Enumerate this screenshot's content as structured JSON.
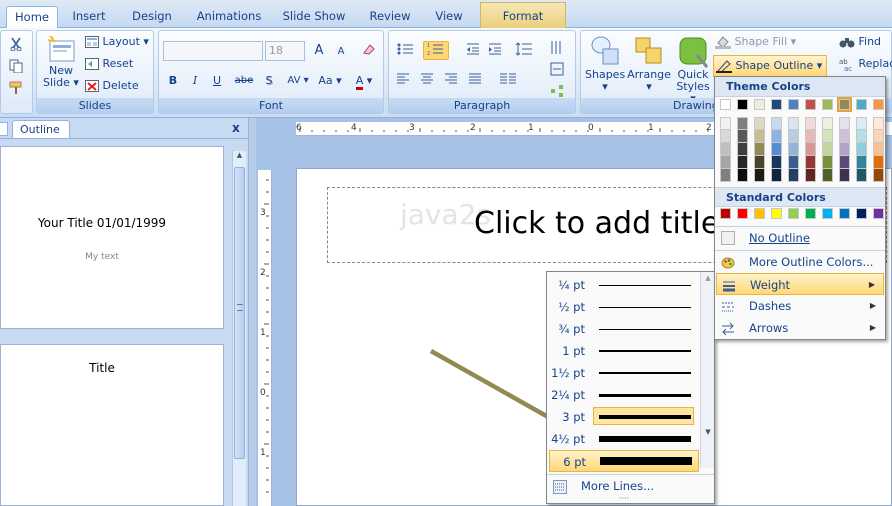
{
  "tabs": [
    {
      "label": "Home",
      "active": true
    },
    {
      "label": "Insert"
    },
    {
      "label": "Design"
    },
    {
      "label": "Animations"
    },
    {
      "label": "Slide Show"
    },
    {
      "label": "Review"
    },
    {
      "label": "View"
    },
    {
      "label": "Format"
    }
  ],
  "ribbon": {
    "slides": {
      "label": "Slides",
      "new_slide_1": "New",
      "new_slide_2": "Slide",
      "layout": "Layout",
      "reset": "Reset",
      "delete": "Delete"
    },
    "font": {
      "label": "Font",
      "size": "18",
      "bold": "B",
      "italic": "I",
      "underline": "U",
      "strike": "abe",
      "shadow": "S",
      "spacing": "AV",
      "case": "Aa",
      "color": "A",
      "grow": "A",
      "shrink": "A"
    },
    "paragraph": {
      "label": "Paragraph"
    },
    "drawing": {
      "label": "Drawing",
      "shapes": "Shapes",
      "arrange": "Arrange",
      "quick_1": "Quick",
      "quick_2": "Styles",
      "shape_fill": "Shape Fill",
      "shape_outline": "Shape Outline"
    },
    "editing": {
      "find": "Find",
      "replace": "Replace"
    }
  },
  "left_panel": {
    "tab": "Outline",
    "close": "x",
    "slide1_title": "Your Title 01/01/1999",
    "slide1_text": "My text",
    "slide2_title": "Title"
  },
  "slide": {
    "title_placeholder": "Click to add title",
    "watermark": "java2s"
  },
  "ruler": {
    "h_ticks": [
      "6",
      "4",
      "3",
      "2",
      "1",
      "0",
      "1",
      "2"
    ],
    "v_ticks": [
      "3",
      "2",
      "1",
      "0",
      "1"
    ]
  },
  "outline_menu": {
    "theme_colors_label": "Theme Colors",
    "standard_colors_label": "Standard Colors",
    "theme_top": [
      "#ffffff",
      "#000000",
      "#eeece1",
      "#1f497d",
      "#4f81bd",
      "#c0504d",
      "#9bbb59",
      "#8064a2",
      "#4bacc6",
      "#f79646"
    ],
    "theme_shades": [
      [
        "#f2f2f2",
        "#d8d8d8",
        "#bfbfbf",
        "#a5a5a5",
        "#7f7f7f"
      ],
      [
        "#7f7f7f",
        "#595959",
        "#3f3f3f",
        "#262626",
        "#0c0c0c"
      ],
      [
        "#ddd9c3",
        "#c4bd97",
        "#938953",
        "#494429",
        "#1d1b10"
      ],
      [
        "#c6d9f0",
        "#8db3e2",
        "#548dd4",
        "#17365d",
        "#0f243e"
      ],
      [
        "#dbe5f1",
        "#b8cce4",
        "#95b3d7",
        "#366092",
        "#244061"
      ],
      [
        "#f2dcdb",
        "#e5b9b7",
        "#d99694",
        "#953734",
        "#632423"
      ],
      [
        "#ebf1dd",
        "#d7e3bc",
        "#c3d69b",
        "#76923c",
        "#4f6128"
      ],
      [
        "#e5e0ec",
        "#ccc1d9",
        "#b2a2c7",
        "#5f497a",
        "#3f3151"
      ],
      [
        "#dbeef3",
        "#b7dde8",
        "#92cddc",
        "#31859b",
        "#205867"
      ],
      [
        "#fdeada",
        "#fbd5b5",
        "#fac08f",
        "#e36c09",
        "#974806"
      ]
    ],
    "standard": [
      "#c00000",
      "#ff0000",
      "#ffc000",
      "#ffff00",
      "#92d050",
      "#00b050",
      "#00b0f0",
      "#0070c0",
      "#002060",
      "#7030a0"
    ],
    "no_outline": "No Outline",
    "more_colors": "More Outline Colors...",
    "weight": "Weight",
    "dashes": "Dashes",
    "arrows": "Arrows"
  },
  "weight_menu": {
    "items": [
      {
        "label": "¼ pt",
        "pt": 0.25
      },
      {
        "label": "½ pt",
        "pt": 0.5
      },
      {
        "label": "¾ pt",
        "pt": 0.75
      },
      {
        "label": "1 pt",
        "pt": 1
      },
      {
        "label": "1½ pt",
        "pt": 1.5
      },
      {
        "label": "2¼ pt",
        "pt": 2.25
      },
      {
        "label": "3 pt",
        "pt": 3,
        "boxed": true
      },
      {
        "label": "4½ pt",
        "pt": 4.5
      },
      {
        "label": "6 pt",
        "pt": 6,
        "selected": true
      }
    ],
    "more_lines": "More Lines..."
  }
}
